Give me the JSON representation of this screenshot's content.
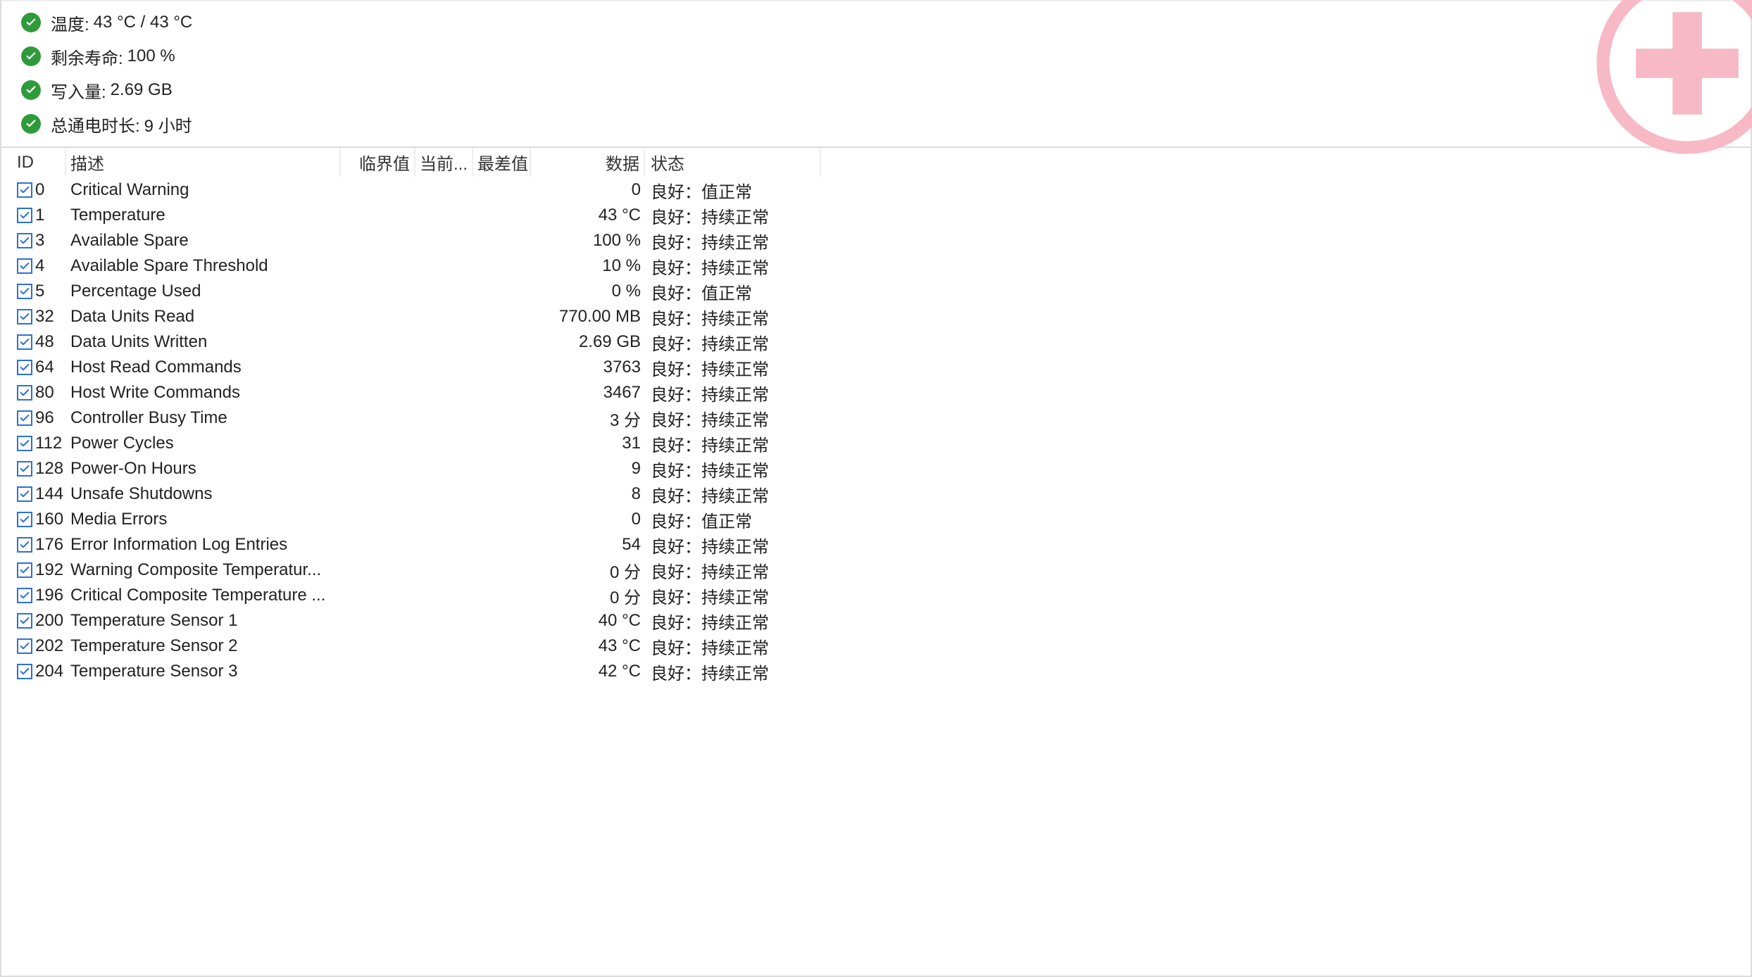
{
  "summary": [
    {
      "label": "温度:",
      "value": "43 °C / 43 °C"
    },
    {
      "label": "剩余寿命:",
      "value": "100 %"
    },
    {
      "label": "写入量:",
      "value": "2.69 GB"
    },
    {
      "label": "总通电时长:",
      "value": "9 小时"
    }
  ],
  "headers": {
    "id": "ID",
    "desc": "描述",
    "thr": "临界值",
    "cur": "当前...",
    "worst": "最差值",
    "data": "数据",
    "status": "状态"
  },
  "rows": [
    {
      "id": "0",
      "desc": "Critical Warning",
      "data": "0",
      "status": "良好：值正常"
    },
    {
      "id": "1",
      "desc": "Temperature",
      "data": "43 °C",
      "status": "良好：持续正常"
    },
    {
      "id": "3",
      "desc": "Available Spare",
      "data": "100 %",
      "status": "良好：持续正常"
    },
    {
      "id": "4",
      "desc": "Available Spare Threshold",
      "data": "10 %",
      "status": "良好：持续正常"
    },
    {
      "id": "5",
      "desc": "Percentage Used",
      "data": "0 %",
      "status": "良好：值正常"
    },
    {
      "id": "32",
      "desc": "Data Units Read",
      "data": "770.00 MB",
      "status": "良好：持续正常"
    },
    {
      "id": "48",
      "desc": "Data Units Written",
      "data": "2.69 GB",
      "status": "良好：持续正常"
    },
    {
      "id": "64",
      "desc": "Host Read Commands",
      "data": "3763",
      "status": "良好：持续正常"
    },
    {
      "id": "80",
      "desc": "Host Write Commands",
      "data": "3467",
      "status": "良好：持续正常"
    },
    {
      "id": "96",
      "desc": "Controller Busy Time",
      "data": "3 分",
      "status": "良好：持续正常"
    },
    {
      "id": "112",
      "desc": "Power Cycles",
      "data": "31",
      "status": "良好：持续正常"
    },
    {
      "id": "128",
      "desc": "Power-On Hours",
      "data": "9",
      "status": "良好：持续正常"
    },
    {
      "id": "144",
      "desc": "Unsafe Shutdowns",
      "data": "8",
      "status": "良好：持续正常"
    },
    {
      "id": "160",
      "desc": "Media Errors",
      "data": "0",
      "status": "良好：值正常"
    },
    {
      "id": "176",
      "desc": "Error Information Log Entries",
      "data": "54",
      "status": "良好：持续正常"
    },
    {
      "id": "192",
      "desc": "Warning Composite Temperatur...",
      "data": "0 分",
      "status": "良好：持续正常"
    },
    {
      "id": "196",
      "desc": "Critical Composite Temperature ...",
      "data": "0 分",
      "status": "良好：持续正常"
    },
    {
      "id": "200",
      "desc": "Temperature Sensor 1",
      "data": "40 °C",
      "status": "良好：持续正常"
    },
    {
      "id": "202",
      "desc": "Temperature Sensor 2",
      "data": "43 °C",
      "status": "良好：持续正常"
    },
    {
      "id": "204",
      "desc": "Temperature Sensor 3",
      "data": "42 °C",
      "status": "良好：持续正常"
    }
  ]
}
